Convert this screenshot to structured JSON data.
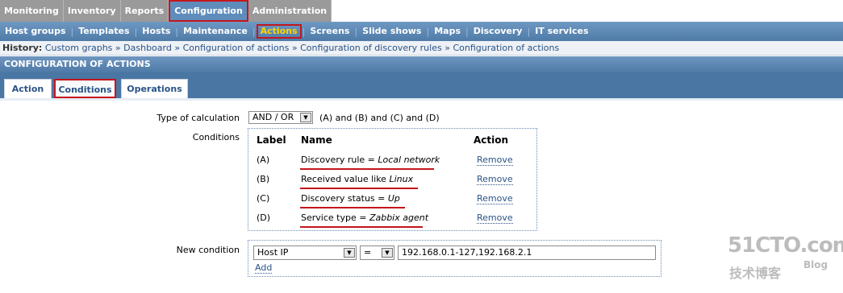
{
  "top_menu": {
    "items": [
      {
        "label": "Monitoring"
      },
      {
        "label": "Inventory"
      },
      {
        "label": "Reports"
      },
      {
        "label": "Configuration"
      },
      {
        "label": "Administration"
      }
    ]
  },
  "sub_menu": {
    "items": [
      {
        "label": "Host groups"
      },
      {
        "label": "Templates"
      },
      {
        "label": "Hosts"
      },
      {
        "label": "Maintenance"
      },
      {
        "label": "Actions"
      },
      {
        "label": "Screens"
      },
      {
        "label": "Slide shows"
      },
      {
        "label": "Maps"
      },
      {
        "label": "Discovery"
      },
      {
        "label": "IT services"
      }
    ],
    "separator": "|"
  },
  "history": {
    "label": "History:",
    "items": [
      "Custom graphs",
      "Dashboard",
      "Configuration of actions",
      "Configuration of discovery rules",
      "Configuration of actions"
    ],
    "separator": "»"
  },
  "page_title": "CONFIGURATION OF ACTIONS",
  "tabs": [
    {
      "label": "Action"
    },
    {
      "label": "Conditions"
    },
    {
      "label": "Operations"
    }
  ],
  "form": {
    "calc_label": "Type of calculation",
    "calc_value": "AND / OR",
    "calc_expression": "(A) and (B) and (C) and (D)",
    "conditions_label": "Conditions",
    "conditions_headers": {
      "label": "Label",
      "name": "Name",
      "action": "Action"
    },
    "conditions": [
      {
        "label": "(A)",
        "name_prefix": "Discovery rule = ",
        "name_value": "Local network",
        "action": "Remove"
      },
      {
        "label": "(B)",
        "name_prefix": "Received value like ",
        "name_value": "Linux",
        "action": "Remove"
      },
      {
        "label": "(C)",
        "name_prefix": "Discovery status = ",
        "name_value": "Up",
        "action": "Remove"
      },
      {
        "label": "(D)",
        "name_prefix": "Service type = ",
        "name_value": "Zabbix agent",
        "action": "Remove"
      }
    ],
    "new_condition_label": "New condition",
    "new_condition_type": "Host IP",
    "new_condition_operator": "=",
    "new_condition_value": "192.168.0.1-127,192.168.2.1",
    "add_label": "Add"
  },
  "watermark": {
    "site": "51CTO.com",
    "sub": "技术博客",
    "blog": "Blog"
  },
  "colors": {
    "accent_red": "#c4161c",
    "menu_blue": "#5f8dbb",
    "link_blue": "#2a5287",
    "active_yellow": "#ffd500"
  }
}
